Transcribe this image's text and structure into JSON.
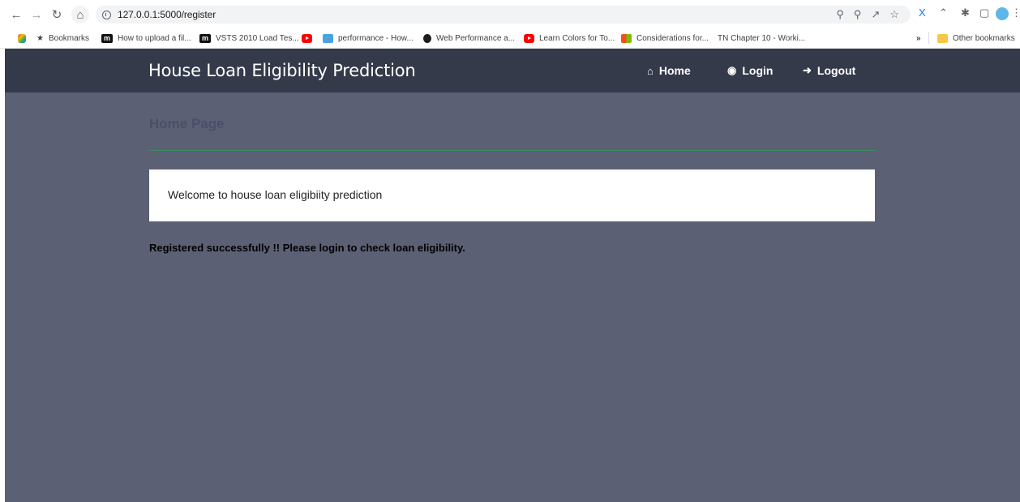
{
  "browser": {
    "url": "127.0.0.1:5000/register",
    "bookmarks_label": "Bookmarks",
    "other_bookmarks": "Other bookmarks",
    "bookmark_items": [
      {
        "label": "How to upload a fil...",
        "icon": "m-icon"
      },
      {
        "label": "VSTS 2010 Load Tes...",
        "icon": "m-icon"
      },
      {
        "label": "",
        "icon": "youtube-icon"
      },
      {
        "label": "performance - How...",
        "icon": "gp-icon"
      },
      {
        "label": "Web Performance a...",
        "icon": "web-perf-icon"
      },
      {
        "label": "Learn Colors for To...",
        "icon": "youtube-icon"
      },
      {
        "label": "Considerations for...",
        "icon": "microsoft-icon"
      },
      {
        "label": "TN  Chapter 10 - Worki...",
        "icon": "tn-icon"
      }
    ]
  },
  "navbar": {
    "brand": "House Loan Eligibility Prediction",
    "links": [
      {
        "label": "Home",
        "icon": "home-icon"
      },
      {
        "label": "Login",
        "icon": "user-circle-icon"
      },
      {
        "label": "Logout",
        "icon": "logout-icon"
      }
    ]
  },
  "main": {
    "title": "Home Page",
    "welcome": "Welcome to house loan eligibiity prediction",
    "status_message": "Registered successfully !! Please login to check loan eligibility."
  },
  "colors": {
    "page_bg": "#5b6075",
    "navbar_bg": "#343a4a",
    "divider": "#3f8a5e"
  }
}
